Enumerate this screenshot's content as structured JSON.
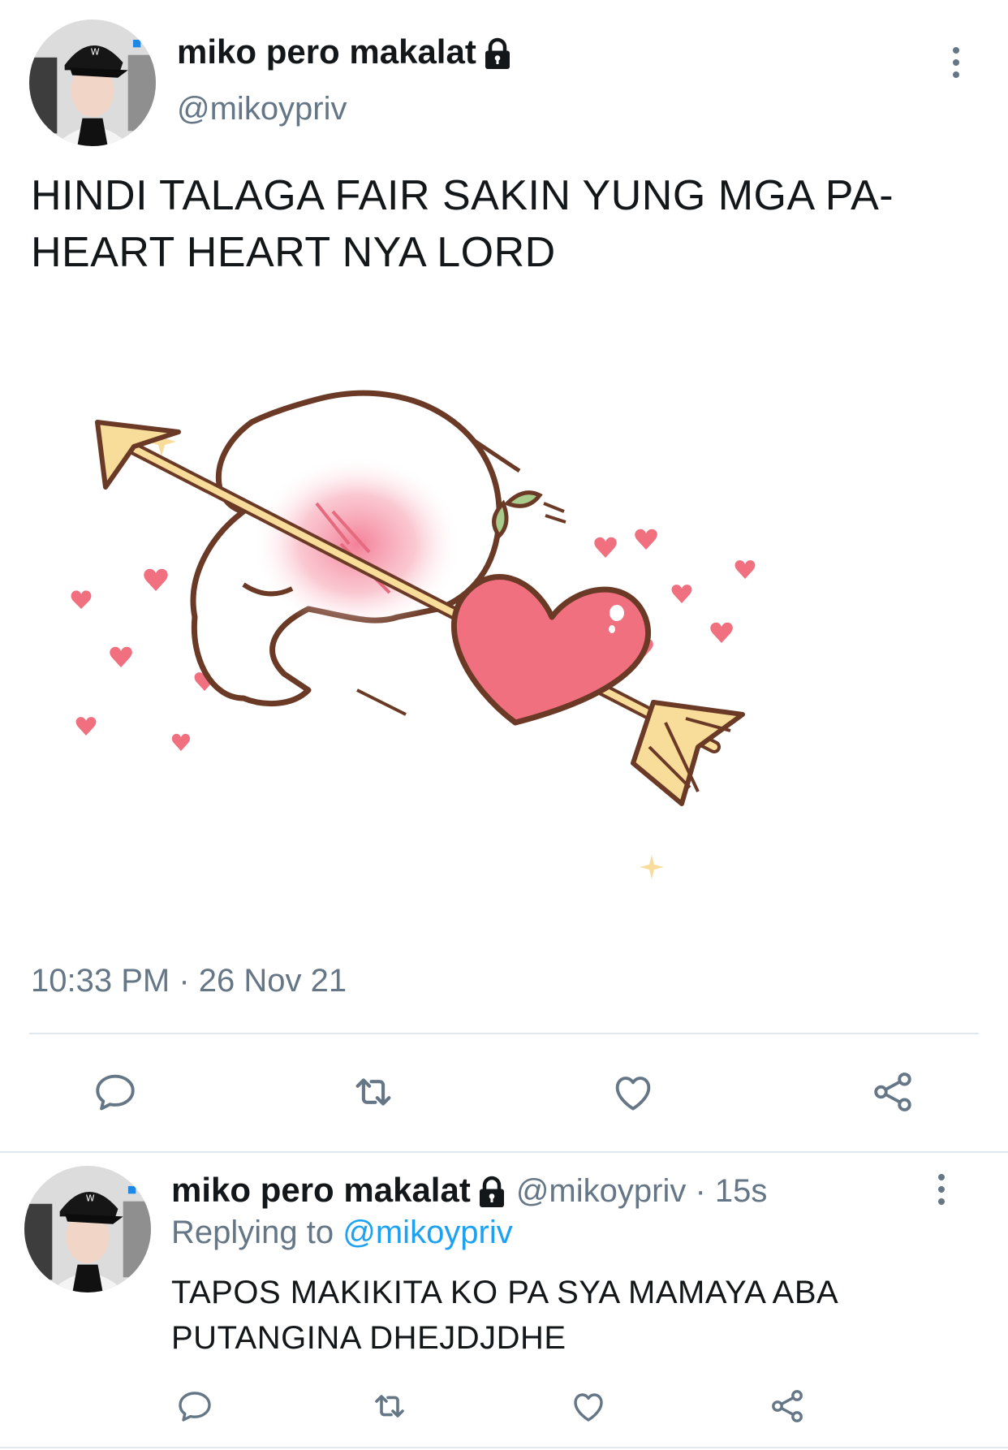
{
  "main_tweet": {
    "display_name": "miko pero makalat",
    "handle": "@mikoypriv",
    "text": "HINDI TALAGA FAIR SAKIN YUNG MGA PA-HEART HEART NYA LORD",
    "timestamp": "10:33 PM · 26 Nov 21",
    "actions": [
      "reply-icon",
      "retweet-icon",
      "like-icon",
      "share-icon"
    ]
  },
  "reply_tweet": {
    "display_name": "miko pero makalat",
    "handle": "@mikoypriv",
    "time_ago": "15s",
    "replying_prefix": "Replying to",
    "replying_to": "@mikoypriv",
    "text": "TAPOS MAKIKITA KO PA SYA MAMAYA ABA PUTANGINA DHEJDJDHE",
    "actions": [
      "reply-icon",
      "retweet-icon",
      "like-icon",
      "share-icon"
    ]
  },
  "colors": {
    "text": "#14171a",
    "secondary": "#657786",
    "link": "#1da1f2",
    "divider": "#e1e8ed",
    "heart": "#f0707f",
    "arrow": "#f7dc9a",
    "outline": "#6b3a26"
  }
}
